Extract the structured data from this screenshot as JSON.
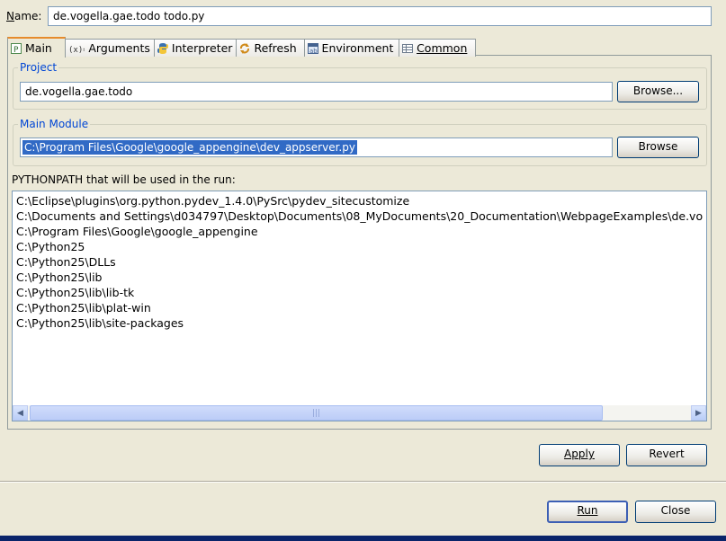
{
  "name_field": {
    "label": "Name:",
    "value": "de.vogella.gae.todo todo.py"
  },
  "tabs": [
    {
      "label": "Main",
      "icon": "main-tab-icon",
      "active": true
    },
    {
      "label": "Arguments",
      "icon": "arguments-icon"
    },
    {
      "label": "Interpreter",
      "icon": "python-icon"
    },
    {
      "label": "Refresh",
      "icon": "refresh-icon"
    },
    {
      "label": "Environment",
      "icon": "environment-icon"
    },
    {
      "label": "Common",
      "icon": "common-icon"
    }
  ],
  "project": {
    "title": "Project",
    "value": "de.vogella.gae.todo",
    "browse_label": "Browse..."
  },
  "main_module": {
    "title": "Main Module",
    "value": "C:\\Program Files\\Google\\google_appengine\\dev_appserver.py",
    "browse_label": "Browse"
  },
  "pythonpath": {
    "label": "PYTHONPATH that will be used in the run:",
    "entries": [
      "C:\\Eclipse\\plugins\\org.python.pydev_1.4.0\\PySrc\\pydev_sitecustomize",
      "C:\\Documents and Settings\\d034797\\Desktop\\Documents\\08_MyDocuments\\20_Documentation\\WebpageExamples\\de.vo",
      "C:\\Program Files\\Google\\google_appengine",
      "C:\\Python25",
      "C:\\Python25\\DLLs",
      "C:\\Python25\\lib",
      "C:\\Python25\\lib\\lib-tk",
      "C:\\Python25\\lib\\plat-win",
      "C:\\Python25\\lib\\site-packages"
    ]
  },
  "buttons": {
    "apply": "Apply",
    "revert": "Revert",
    "run": "Run",
    "close": "Close"
  },
  "colors": {
    "accent_tab": "#e68b2c",
    "selection": "#316ac5",
    "group_title": "#0046d5"
  }
}
